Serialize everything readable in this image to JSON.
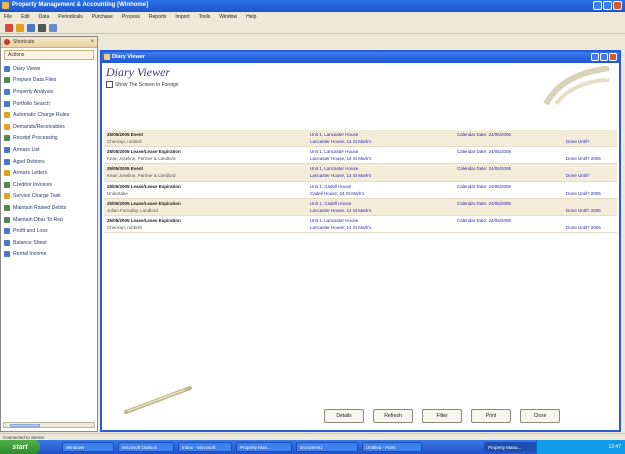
{
  "window": {
    "title": "Property Management & Accounting [Winhome]"
  },
  "menu": [
    "File",
    "Edit",
    "Data",
    "Periodicals",
    "Purchase",
    "Process",
    "Reports",
    "Import",
    "Tools",
    "Window",
    "Help"
  ],
  "toolbar_icons": [
    "new-icon",
    "open-icon",
    "print-icon",
    "search-icon",
    "save-icon"
  ],
  "sidebar": {
    "header": "Shortcuts",
    "close": "×",
    "section": "Actions",
    "items": [
      {
        "label": "Diary Views",
        "icon": "calendar-icon",
        "color": "#4a78c8"
      },
      {
        "label": "Prepare Data Files",
        "icon": "file-icon",
        "color": "#4a8a4a"
      },
      {
        "label": "Property Analysis",
        "icon": "chart-icon",
        "color": "#4a78c8"
      },
      {
        "label": "Portfolio Search",
        "icon": "search-icon",
        "color": "#4a78c8"
      },
      {
        "label": "Automatic Charge Rules",
        "icon": "gear-icon",
        "color": "#e0a020"
      },
      {
        "label": "Demands/Receivables",
        "icon": "money-icon",
        "color": "#e0a020"
      },
      {
        "label": "Receipt Processing",
        "icon": "receipt-icon",
        "color": "#4a8a4a"
      },
      {
        "label": "Arrears List",
        "icon": "list-icon",
        "color": "#4a78c8"
      },
      {
        "label": "Aged Debtors",
        "icon": "clock-icon",
        "color": "#4a78c8"
      },
      {
        "label": "Arrears Letters",
        "icon": "letter-icon",
        "color": "#e0a020"
      },
      {
        "label": "Creditor Invoices",
        "icon": "invoice-icon",
        "color": "#4a8a4a"
      },
      {
        "label": "Service Charge Task",
        "icon": "task-icon",
        "color": "#e0a020"
      },
      {
        "label": "Maintain Raised Debits",
        "icon": "edit-icon",
        "color": "#4a8a4a"
      },
      {
        "label": "Maintain Dbar To Rep",
        "icon": "edit-icon",
        "color": "#4a8a4a"
      },
      {
        "label": "Profit and Loss",
        "icon": "chart-icon",
        "color": "#4a78c8"
      },
      {
        "label": "Balance Sheet",
        "icon": "sheet-icon",
        "color": "#4a78c8"
      },
      {
        "label": "Rental Income",
        "icon": "income-icon",
        "color": "#4a78c8"
      }
    ]
  },
  "viewer": {
    "title": "Diary Viewer",
    "heading": "Diary Viewer",
    "checkbox_label": "Show The Screen In Foreign",
    "entries": [
      {
        "shade": true,
        "a1": "25/05/2005 Event",
        "a2": "Checkup, rubbish",
        "b1": "Unit 1, Lancaster House",
        "b2": "Lancaster House, 14 St Mark's",
        "c1": "Calendar Date: 24/05/2006",
        "c2": "",
        "d1": "",
        "d2": "Done Until?"
      },
      {
        "shade": false,
        "a1": "25/05/2005 Lease/Lease Expiration",
        "a2": "Kean Joseline, Partner & Landlord",
        "b1": "Unit 1, Lancaster House",
        "b2": "Lancaster House, 14 St Mark's",
        "c1": "Calendar Date: 24/05/2006",
        "c2": "",
        "d1": "",
        "d2": "Done Until? 2006"
      },
      {
        "shade": true,
        "a1": "25/05/2005 Event",
        "a2": "Kean Joseline, Partner & Landlord",
        "b1": "Unit 1, Lancaster House",
        "b2": "Lancaster House, 14 St Mark's",
        "c1": "Calendar Date: 24/05/2006",
        "c2": "",
        "d1": "",
        "d2": "Done Until?"
      },
      {
        "shade": false,
        "a1": "25/05/2005 Lease/Lease Expiration",
        "a2": "Undertake",
        "b1": "Unit 1, Cadell House",
        "b2": "Cadell House, 24 St Mark's",
        "c1": "Calendar Date: 24/05/2006",
        "c2": "",
        "d1": "",
        "d2": "Done Until? 2006"
      },
      {
        "shade": true,
        "a1": "25/05/2005 Lease/Lease Expiration",
        "a2": "Julian Farraday, Landlord",
        "b1": "Unit 1, Cadell House",
        "b2": "Lancaster House, 14 St Mark's",
        "c1": "Calendar Date: 24/05/2006",
        "c2": "",
        "d1": "",
        "d2": "Done Until? 2006"
      },
      {
        "shade": false,
        "a1": "25/05/2005 Lease/Lease Expiration",
        "a2": "Checkup, rubbish",
        "b1": "Unit 1, Lancaster House",
        "b2": "Lancaster House, 14 St Mark's",
        "c1": "Calendar Date: 24/05/2006",
        "c2": "",
        "d1": "",
        "d2": "Done Until? 2006"
      }
    ],
    "buttons": [
      "Details",
      "Refresh",
      "Filter",
      "Print",
      "Close"
    ]
  },
  "statusbar": {
    "text": "Connected to Server"
  },
  "taskbar": {
    "start": "start",
    "tasks": [
      "Windows",
      "Microsoft Outlook",
      "Inbox - Microsoft",
      "Property Man...",
      "Document1",
      "Untitled - Paint",
      "Property Mana..."
    ],
    "clock": "12:47"
  }
}
